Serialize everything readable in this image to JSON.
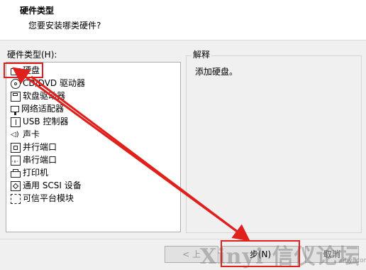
{
  "header": {
    "title": "硬件类型",
    "subtitle": "您要安装哪类硬件?"
  },
  "hardware_type_label": "硬件类型(H):",
  "hardware_items": [
    {
      "label": "硬盘",
      "icon": "hard-disk-icon",
      "selected": true
    },
    {
      "label": "CD/DVD 驱动器",
      "icon": "cd-dvd-icon"
    },
    {
      "label": "软盘驱动器",
      "icon": "floppy-icon"
    },
    {
      "label": "网络适配器",
      "icon": "network-adapter-icon"
    },
    {
      "label": "USB 控制器",
      "icon": "usb-icon"
    },
    {
      "label": "声卡",
      "icon": "sound-card-icon"
    },
    {
      "label": "并行端口",
      "icon": "parallel-port-icon"
    },
    {
      "label": "串行端口",
      "icon": "serial-port-icon"
    },
    {
      "label": "打印机",
      "icon": "printer-icon"
    },
    {
      "label": "通用 SCSI 设备",
      "icon": "scsi-icon"
    },
    {
      "label": "可信平台模块",
      "icon": "tpm-icon"
    }
  ],
  "explanation": {
    "legend": "解释",
    "text": "添加硬盘。"
  },
  "buttons": {
    "back": "< 上",
    "next": "步(N)",
    "cancel": "取消"
  },
  "watermark": {
    "text": "Xinyi 信仪论坛",
    "sub": "xinyi.com"
  },
  "colors": {
    "annotation_red": "#e0201c",
    "window_bg": "#f0f0f0",
    "header_bg": "#ffffff"
  }
}
